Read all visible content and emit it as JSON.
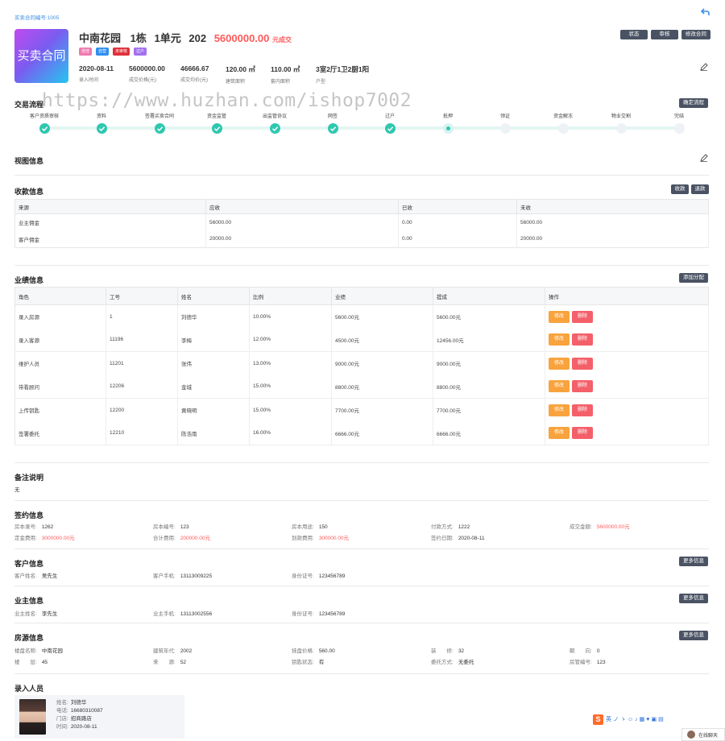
{
  "header": {
    "contract_no_label": "买卖合同编号:",
    "contract_no": "1005",
    "logo_text": "买卖合同",
    "property": "中南花园",
    "building": "1栋",
    "unit": "1单元",
    "room": "202",
    "price": "5600000.00",
    "status": "元成交",
    "tags": [
      {
        "text": "佳佳",
        "color": "#f07ab0"
      },
      {
        "text": "自营",
        "color": "#2f8ef0"
      },
      {
        "text": "未审核",
        "color": "#e0303a"
      },
      {
        "text": "过户",
        "color": "#a371f0"
      }
    ],
    "stats": [
      {
        "value": "2020-08-11",
        "label": "录入时间"
      },
      {
        "value": "5600000.00",
        "label": "成交价格(元)"
      },
      {
        "value": "46666.67",
        "label": "成交均价(元)"
      },
      {
        "value": "120.00 ㎡",
        "label": "建筑面积"
      },
      {
        "value": "110.00 ㎡",
        "label": "套内面积"
      },
      {
        "value": "3室2厅1卫2厨1阳",
        "label": "户型"
      }
    ],
    "buttons": [
      "状态",
      "审核",
      "修改合同"
    ]
  },
  "watermark": "https://www.huzhan.com/ishop7002",
  "process": {
    "title": "交易流程",
    "button": "确定流程",
    "steps": [
      {
        "label": "客户资质审核",
        "state": "done"
      },
      {
        "label": "资料",
        "state": "done"
      },
      {
        "label": "签署买卖合同",
        "state": "done"
      },
      {
        "label": "资金监管",
        "state": "done"
      },
      {
        "label": "出监管协议",
        "state": "done"
      },
      {
        "label": "网签",
        "state": "done"
      },
      {
        "label": "过户",
        "state": "done"
      },
      {
        "label": "抵押",
        "state": "current"
      },
      {
        "label": "领证",
        "state": "todo"
      },
      {
        "label": "资金解冻",
        "state": "todo"
      },
      {
        "label": "物业交割",
        "state": "todo"
      },
      {
        "label": "完结",
        "state": "todo"
      }
    ]
  },
  "view_info": {
    "title": "视图信息"
  },
  "payment": {
    "title": "收款信息",
    "buttons": [
      "收款",
      "退款"
    ],
    "columns": [
      "来源",
      "应收",
      "已收",
      "未收"
    ],
    "rows": [
      [
        "业主佣金",
        "56000.00",
        "0.00",
        "56000.00"
      ],
      [
        "客户佣金",
        "20000.00",
        "0.00",
        "20000.00"
      ]
    ]
  },
  "performance": {
    "title": "业绩信息",
    "button": "添加分配",
    "columns": [
      "角色",
      "工号",
      "姓名",
      "比例",
      "业绩",
      "提成",
      "操作"
    ],
    "edit_label": "修改",
    "delete_label": "删除",
    "rows": [
      [
        "录入房源",
        "1",
        "刘德华",
        "10.00%",
        "5600.00元",
        "5600.00元"
      ],
      [
        "录入客源",
        "11196",
        "李梅",
        "12.00%",
        "4500.00元",
        "12456.00元"
      ],
      [
        "维护人员",
        "11201",
        "张伟",
        "13.00%",
        "9000.00元",
        "9000.00元"
      ],
      [
        "带看顾问",
        "12206",
        "金城",
        "15.00%",
        "8800.00元",
        "8800.00元"
      ],
      [
        "上传钥匙",
        "12200",
        "黄晓明",
        "15.00%",
        "7700.00元",
        "7700.00元"
      ],
      [
        "签署委托",
        "12210",
        "陈浩南",
        "16.00%",
        "6666.00元",
        "6666.00元"
      ]
    ]
  },
  "remarks": {
    "title": "备注说明",
    "text": "无"
  },
  "signing": {
    "title": "签约信息",
    "fields": [
      {
        "label": "房本录号:",
        "value": "1262",
        "red": false
      },
      {
        "label": "房本编号:",
        "value": "123",
        "red": false
      },
      {
        "label": "房本用途:",
        "value": "150",
        "red": false
      },
      {
        "label": "付款方式:",
        "value": "1222",
        "red": false
      },
      {
        "label": "成交金额:",
        "value": "5600000.00元",
        "red": true
      },
      {
        "label": "定金费用:",
        "value": "3000000.00元",
        "red": true
      },
      {
        "label": "合计费用:",
        "value": "200000.00元",
        "red": true
      },
      {
        "label": "划款费用:",
        "value": "300000.00元",
        "red": true
      },
      {
        "label": "签约日期:",
        "value": "2020-08-11",
        "red": false
      }
    ]
  },
  "customer": {
    "title": "客户信息",
    "button": "更多信息",
    "fields": [
      {
        "label": "客户姓名:",
        "value": "吴先生"
      },
      {
        "label": "客户手机:",
        "value": "13113009225"
      },
      {
        "label": "身份证号:",
        "value": "123456789"
      }
    ]
  },
  "owner": {
    "title": "业主信息",
    "button": "更多信息",
    "fields": [
      {
        "label": "业主姓名:",
        "value": "李先生"
      },
      {
        "label": "业主手机:",
        "value": "13113002556"
      },
      {
        "label": "身份证号:",
        "value": "123456789"
      }
    ]
  },
  "house": {
    "title": "房源信息",
    "button": "更多信息",
    "fields": [
      {
        "label": "楼盘名称:",
        "value": "中南花园"
      },
      {
        "label": "建筑年代:",
        "value": "2002"
      },
      {
        "label": "挂盘价格:",
        "value": "560.00"
      },
      {
        "label": "装　　修:",
        "value": "32"
      },
      {
        "label": "朝　　向:",
        "value": "0"
      },
      {
        "label": "楼　　层:",
        "value": "45"
      },
      {
        "label": "来　　源:",
        "value": "52"
      },
      {
        "label": "钥匙状态:",
        "value": "有"
      },
      {
        "label": "委托方式:",
        "value": "无委托"
      },
      {
        "label": "房管编号:",
        "value": "123"
      }
    ]
  },
  "recorder": {
    "title": "录入人员",
    "fields": [
      {
        "label": "姓名:",
        "value": "刘德华"
      },
      {
        "label": "电话:",
        "value": "16680310087"
      },
      {
        "label": "门店:",
        "value": "招商路店"
      },
      {
        "label": "时间:",
        "value": "2020-08-11"
      }
    ]
  },
  "ime_bar": {
    "logo": "S",
    "items": [
      "英",
      "ノ",
      "ゝ",
      "☺",
      "♪",
      "▦",
      "♥",
      "▣",
      "▤"
    ]
  },
  "chat": {
    "label": "在线聊天"
  }
}
